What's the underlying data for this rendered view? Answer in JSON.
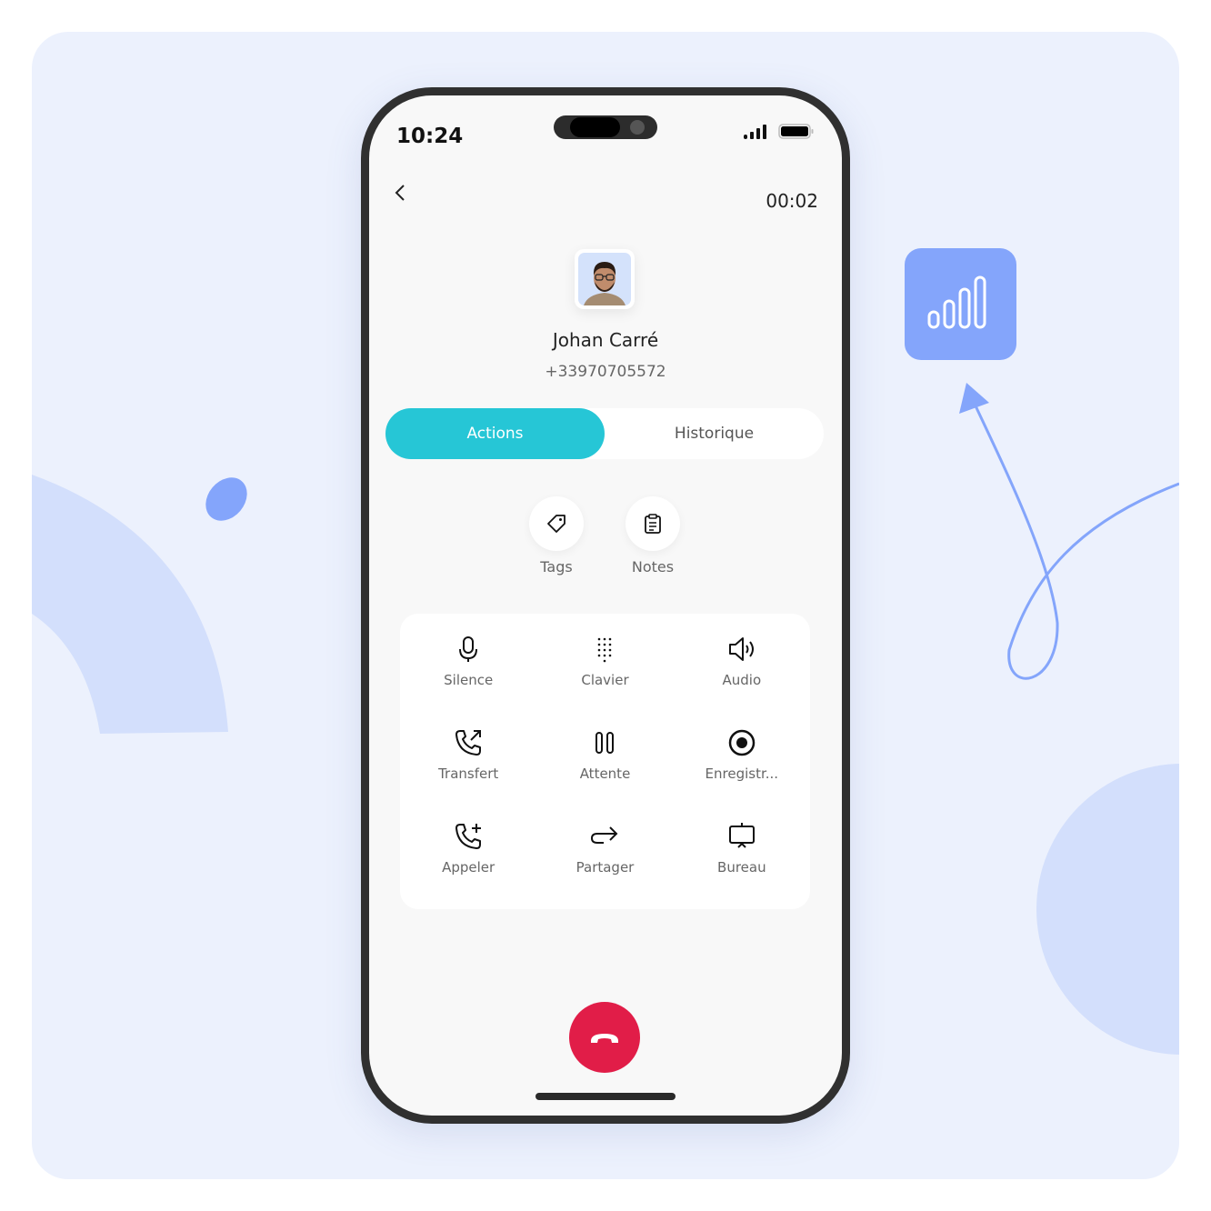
{
  "status_bar": {
    "time": "10:24",
    "signal_icon": "signal-bars-icon",
    "battery_icon": "battery-full-icon"
  },
  "call": {
    "timer": "00:02",
    "contact_name": "Johan Carré",
    "phone_number": "+33970705572"
  },
  "tabs": [
    {
      "label": "Actions",
      "active": true
    },
    {
      "label": "Historique",
      "active": false
    }
  ],
  "quick_actions": [
    {
      "label": "Tags",
      "icon": "tag-icon"
    },
    {
      "label": "Notes",
      "icon": "clipboard-icon"
    }
  ],
  "actions": [
    {
      "label": "Silence",
      "icon": "microphone-icon"
    },
    {
      "label": "Clavier",
      "icon": "keypad-icon"
    },
    {
      "label": "Audio",
      "icon": "speaker-icon"
    },
    {
      "label": "Transfert",
      "icon": "phone-transfer-icon"
    },
    {
      "label": "Attente",
      "icon": "pause-icon"
    },
    {
      "label": "Enregistr...",
      "icon": "record-icon"
    },
    {
      "label": "Appeler",
      "icon": "phone-add-icon"
    },
    {
      "label": "Partager",
      "icon": "share-arrow-icon"
    },
    {
      "label": "Bureau",
      "icon": "presentation-icon"
    }
  ],
  "colors": {
    "accent": "#26c6d6",
    "hangup": "#e11d48",
    "background": "#ecf1fd",
    "decor_blue": "#84a5fb"
  }
}
